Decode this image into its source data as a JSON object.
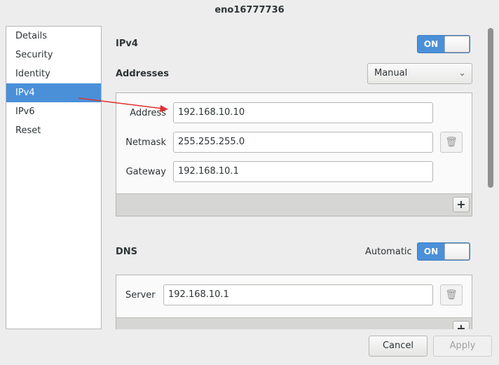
{
  "window": {
    "title": "eno16777736"
  },
  "sidebar": {
    "items": [
      {
        "label": "Details"
      },
      {
        "label": "Security"
      },
      {
        "label": "Identity"
      },
      {
        "label": "IPv4"
      },
      {
        "label": "IPv6"
      },
      {
        "label": "Reset"
      }
    ],
    "selected": "IPv4"
  },
  "ipv4": {
    "heading": "IPv4",
    "toggle": "ON"
  },
  "addresses": {
    "heading": "Addresses",
    "method": "Manual",
    "fields": [
      {
        "label": "Address",
        "value": "192.168.10.10"
      },
      {
        "label": "Netmask",
        "value": "255.255.255.0"
      },
      {
        "label": "Gateway",
        "value": "192.168.10.1"
      }
    ],
    "add": "+"
  },
  "dns": {
    "heading": "DNS",
    "auto_label": "Automatic",
    "toggle": "ON",
    "server_label": "Server",
    "server_value": "192.168.10.1",
    "add": "+"
  },
  "buttons": {
    "cancel": "Cancel",
    "apply": "Apply"
  },
  "colors": {
    "accent": "#4a90d9",
    "annotation_arrow": "#e03030"
  }
}
